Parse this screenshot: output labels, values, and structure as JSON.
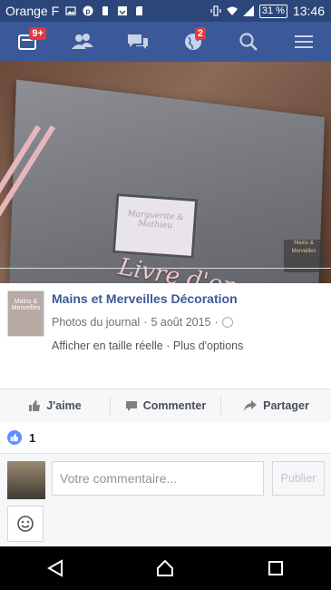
{
  "statusbar": {
    "carrier": "Orange F",
    "battery": "31 %",
    "time": "13:46"
  },
  "navbar": {
    "notifications_badge": "9+",
    "globe_badge": "2",
    "icons": [
      "news-feed-icon",
      "friends-icon",
      "messages-icon",
      "notifications-globe-icon",
      "search-icon",
      "menu-icon"
    ],
    "color": "#3b5998"
  },
  "photo": {
    "overlay_text": "Livre d'or",
    "window_text": "Marguerite & Mathieu",
    "watermark_text": "Mains & Merveilles"
  },
  "post": {
    "page_name": "Mains et Merveilles Décoration",
    "avatar_text": "Mains & Merveilles",
    "album": "Photos du journal",
    "date": "5 août 2015",
    "separator": "·",
    "link_full_size": "Afficher en taille réelle",
    "link_more": "Plus d'options"
  },
  "actions": {
    "like": "J'aime",
    "comment": "Commenter",
    "share": "Partager"
  },
  "likes": {
    "count": "1"
  },
  "comment": {
    "placeholder": "Votre commentaire...",
    "post_button": "Publier"
  }
}
